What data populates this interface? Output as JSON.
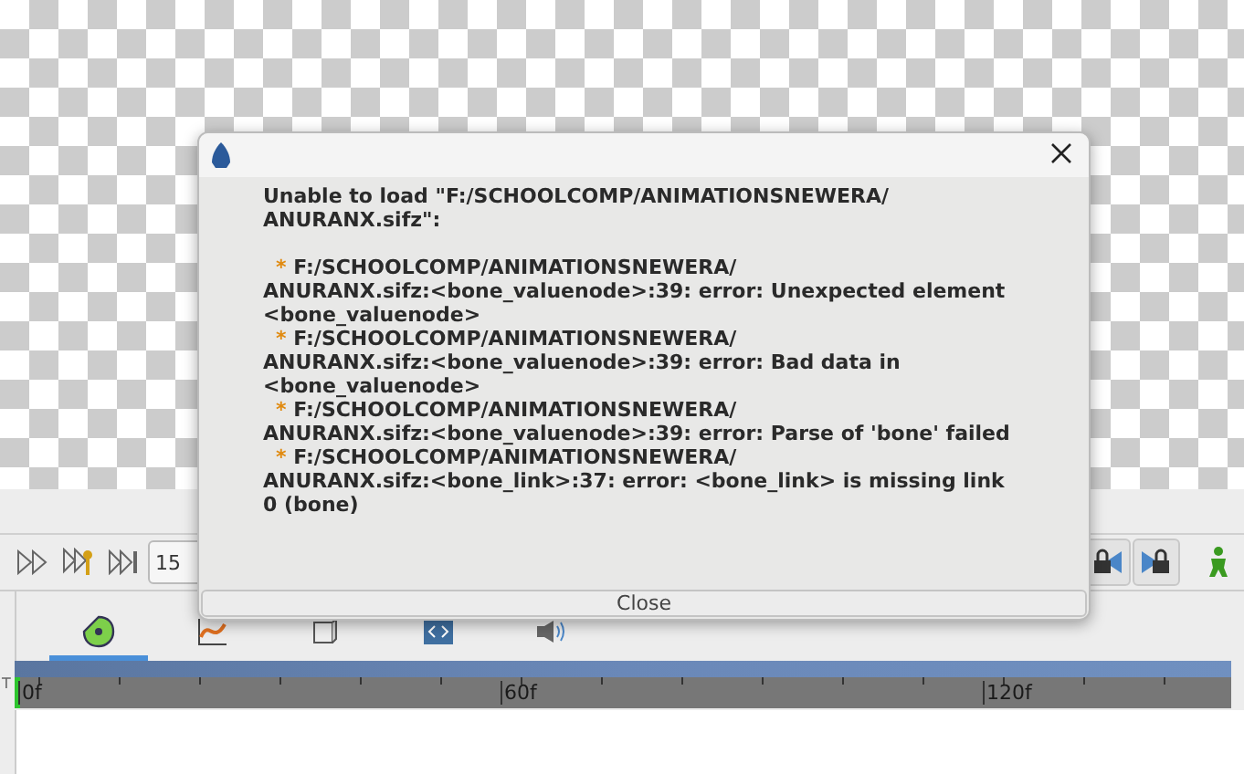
{
  "toolbar": {
    "frame_field": {
      "value": "15"
    }
  },
  "panel_tabs": [
    {
      "selected": true
    },
    {
      "selected": false
    },
    {
      "selected": false
    },
    {
      "selected": false
    },
    {
      "selected": false
    }
  ],
  "timeline": {
    "labels": [
      "0f",
      "60f",
      "120f"
    ],
    "side_label": "T"
  },
  "dialog": {
    "heading_lines": [
      "Unable to load \"F:/SCHOOLCOMP/ANIMATIONSNEWERA/",
      "ANURANX.sifz\":"
    ],
    "errors": [
      {
        "bullet": "*",
        "lines": [
          "F:/SCHOOLCOMP/ANIMATIONSNEWERA/",
          "ANURANX.sifz:<bone_valuenode>:39: error: Unexpected element",
          "<bone_valuenode>"
        ]
      },
      {
        "bullet": "*",
        "lines": [
          "F:/SCHOOLCOMP/ANIMATIONSNEWERA/",
          "ANURANX.sifz:<bone_valuenode>:39: error: Bad data in",
          "<bone_valuenode>"
        ]
      },
      {
        "bullet": "*",
        "lines": [
          "F:/SCHOOLCOMP/ANIMATIONSNEWERA/",
          "ANURANX.sifz:<bone_valuenode>:39: error: Parse of 'bone' failed"
        ]
      },
      {
        "bullet": "*",
        "lines": [
          "F:/SCHOOLCOMP/ANIMATIONSNEWERA/",
          "ANURANX.sifz:<bone_link>:37: error: <bone_link> is missing link",
          "0 (bone)"
        ]
      }
    ],
    "close_button": "Close"
  }
}
